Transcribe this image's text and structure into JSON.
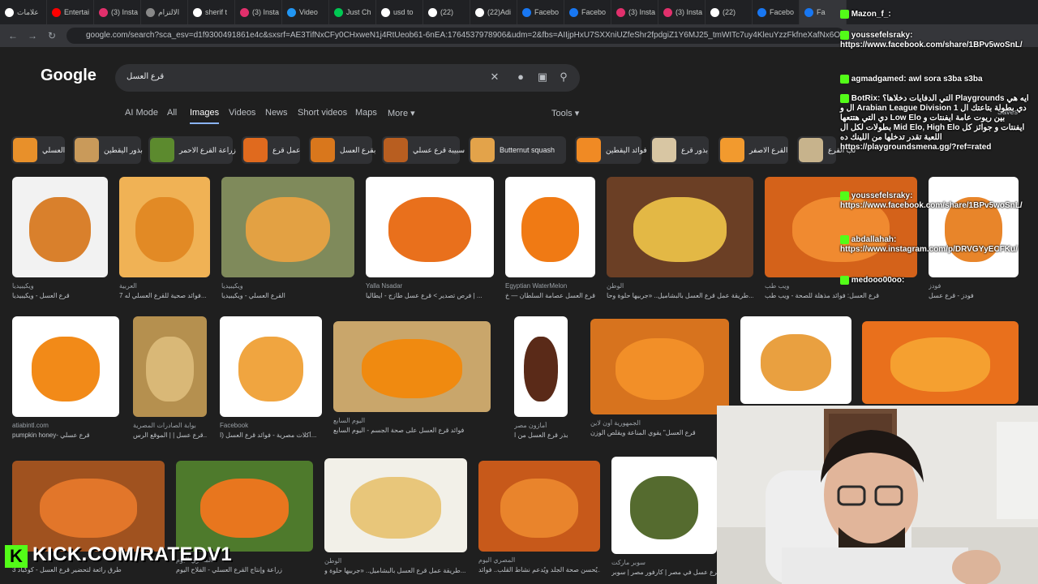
{
  "tabs": [
    {
      "label": "علامات",
      "color": "#ffffff"
    },
    {
      "label": "Entertai",
      "color": "#ff0000"
    },
    {
      "label": "(3) Insta",
      "color": "#e1306c"
    },
    {
      "label": "الالتزام",
      "color": "#888888"
    },
    {
      "label": "sherif t",
      "color": "#ffffff"
    },
    {
      "label": "(3) Insta",
      "color": "#e1306c"
    },
    {
      "label": "Video",
      "color": "#2196f3"
    },
    {
      "label": "Just Ch",
      "color": "#00c853"
    },
    {
      "label": "usd to",
      "color": "#ffffff"
    },
    {
      "label": "(22)",
      "color": "#ffffff"
    },
    {
      "label": "(22)Adi",
      "color": "#ffffff"
    },
    {
      "label": "Facebo",
      "color": "#1877f2"
    },
    {
      "label": "Facebo",
      "color": "#1877f2"
    },
    {
      "label": "(3) Insta",
      "color": "#e1306c"
    },
    {
      "label": "(3) Insta",
      "color": "#e1306c"
    },
    {
      "label": "(22)",
      "color": "#ffffff"
    },
    {
      "label": "Facebo",
      "color": "#1877f2"
    },
    {
      "label": "Fa",
      "color": "#1877f2"
    }
  ],
  "address": {
    "url": "google.com/search?sca_esv=d1f9300491861e4c&sxsrf=AE3TifNxCFy0CHxweN1j4RtUeob61-6nEA:1764537978906&udm=2&fbs=AIIjpHxU7SXXniUZfeShr2fpdgiZ1Y6MJ25_tmWITc7uy4KleuYzzFkfneXafNx6OMdA4MQRJc_t_TQjwH"
  },
  "google": {
    "logo": "Google",
    "query": "قرع العسل",
    "filters": [
      "AI Mode",
      "All",
      "Images",
      "Videos",
      "News",
      "Short videos",
      "Maps",
      "More"
    ],
    "active_filter": "Images",
    "tools": "Tools",
    "saves": "Saves"
  },
  "chips": [
    {
      "label": "العسلي",
      "color": "#e8902a"
    },
    {
      "label": "بذور اليقطين",
      "color": "#c99a5a"
    },
    {
      "label": "زراعة القرع الاحمر",
      "color": "#5c8a2e"
    },
    {
      "label": "عمل قرع",
      "color": "#e06a1e"
    },
    {
      "label": "بقرع العسل",
      "color": "#d9771c"
    },
    {
      "label": "سبيبة قرع عسلي",
      "color": "#b85e20"
    },
    {
      "label": "Butternut squash",
      "color": "#e3a34a"
    },
    {
      "label": "فوائد اليقطين",
      "color": "#f08a24"
    },
    {
      "label": "بذور قرع",
      "color": "#d8c6a3"
    },
    {
      "label": "القرع الاصفر",
      "color": "#f29a2e"
    },
    {
      "label": "لب القرع",
      "color": "#c7b38c"
    }
  ],
  "images": [
    {
      "src": "ويكيبيديا",
      "cap": "قرع العسل - ويكيبيديا",
      "bg": "#f2f2f2",
      "fg": "#d9802c"
    },
    {
      "src": "العربية",
      "cap": "7 فوائد صحية للقرع العسلي له...",
      "bg": "#f0b255",
      "fg": "#e28a25"
    },
    {
      "src": "ويكيبيديا",
      "cap": "القرع العسلي - ويكيبيديا",
      "bg": "#7f8a5b",
      "fg": "#e3a143"
    },
    {
      "src": "Yalla Nsadar",
      "cap": "فرص تصدير > قرع عسل طازج - ايطاليا | ...",
      "bg": "#ffffff",
      "fg": "#e9701c"
    },
    {
      "src": "Egyptian WaterMelon",
      "cap": "قرع العسل عصامة السلطان — خ...",
      "bg": "#ffffff",
      "fg": "#f07a14"
    },
    {
      "src": "الوطن",
      "cap": "طريقة عمل قرع العسل بالبشاميل.. «جربيها حلوة وحا...",
      "bg": "#6b3f25",
      "fg": "#e3b845"
    },
    {
      "src": "ويب طب",
      "cap": "قرع العسل: فوائد مذهلة للصحة - ويب طب",
      "bg": "#d4621a",
      "fg": "#f08a30"
    },
    {
      "src": "فودز",
      "cap": "فودز - قرع عسل",
      "bg": "#ffffff",
      "fg": "#e8852a"
    },
    {
      "src": "atiabintl.com",
      "cap": "pumpkin honey- قرع عسلي",
      "bg": "#ffffff",
      "fg": "#f28a18"
    },
    {
      "src": "بوابة الصادرات المصرية",
      "cap": "قرع عسل | | الموقع الرس...",
      "bg": "#b5904f",
      "fg": "#d9b877"
    },
    {
      "src": "Facebook",
      "cap": "أكلات مصرية - فوائد قرع العسل (ا...",
      "bg": "#ffffff",
      "fg": "#f0a540"
    },
    {
      "src": "اليوم السابع",
      "cap": "فوائد قرع العسل على صحة الجسم - اليوم السابع",
      "bg": "#c9a66b",
      "fg": "#f08a10"
    },
    {
      "src": "أمازون مصر",
      "cap": "زيت بذر قرع العسل من ا...",
      "bg": "#ffffff",
      "fg": "#5a2a18"
    },
    {
      "src": "الجمهورية أون لاين",
      "cap": "قرع العسل\" يقوي المناعة ويقلص الوزن",
      "bg": "#d7731e",
      "fg": "#f28f28"
    },
    {
      "src": "",
      "cap": "",
      "bg": "#ffffff",
      "fg": "#e9a040"
    },
    {
      "src": "",
      "cap": "",
      "bg": "#e9701c",
      "fg": "#f5a030"
    },
    {
      "src": "",
      "cap": "3 طرق رائعة لتحضير قرع العسل - كوكباد",
      "bg": "#a0521f",
      "fg": "#e2762a"
    },
    {
      "src": "المصري اليوم",
      "cap": "زراعة وإنتاج القرع العسلي - الفلاح اليوم",
      "bg": "#4e7a2c",
      "fg": "#e8761e"
    },
    {
      "src": "الوطن",
      "cap": "طريقة عمل قرع العسل بالبشاميل.. «جربيها حلوة و...",
      "bg": "#f2f0e8",
      "fg": "#e8c67a"
    },
    {
      "src": "المصري اليوم",
      "cap": "يُحسن صحة الجلد ويُدعم نشاط القلب.. فوائد...",
      "bg": "#c7591a",
      "fg": "#e9842c"
    },
    {
      "src": "سوبر ماركت",
      "cap": "قرع عسل في مصر | كارفور مصر | سوبر...",
      "bg": "#ffffff",
      "fg": "#556b2f"
    }
  ],
  "chat": [
    {
      "user": "Mazon_f_",
      "msg": ""
    },
    {
      "user": "youssefelsraky",
      "msg": "https://www.facebook.com/share/1BPv5woSnL/"
    },
    {
      "user": "agmadgamed",
      "msg": "awl sora s3ba s3ba"
    },
    {
      "user": "BotRix",
      "msg": "التي الدفايات دخلاها؟ Playgrounds ايه هي ال و Arabian League Division 1 دي بطولة بتاعتك ال دي التي هتتعها Low Elo بين ريوت عامة ايفنتات و بطولات لكل ال Mid Elo, High Elo ايفنتات و جوائز كل اللعبة تقدر تدخلها من اللينك ده https://playgroundsmena.gg/?ref=rated"
    },
    {
      "user": "youssefelsraky",
      "msg": "https://www.facebook.com/share/1BPv5woSnL/"
    },
    {
      "user": "abdallahah",
      "msg": "https://www.instagram.com/p/DRVGYyECFKu/"
    },
    {
      "user": "medooo00oo",
      "msg": ""
    }
  ],
  "overlay": {
    "kick": "KICK.COM/RATEDV1",
    "kick_k": "K"
  }
}
